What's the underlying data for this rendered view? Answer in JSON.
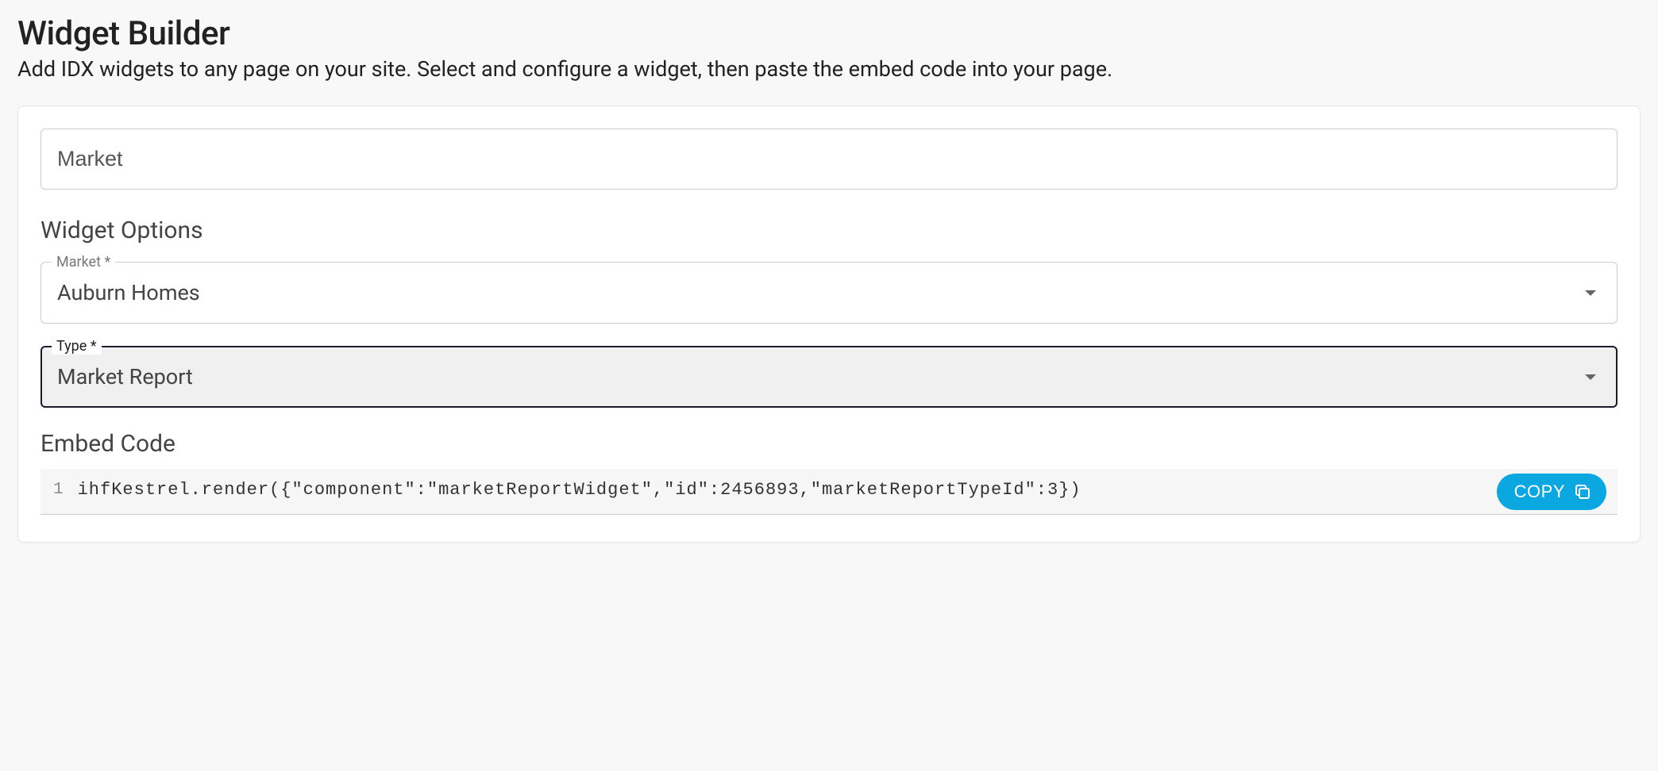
{
  "header": {
    "title": "Widget Builder",
    "subtitle": "Add IDX widgets to any page on your site. Select and configure a widget, then paste the embed code into your page."
  },
  "widget_name": "Market",
  "options_heading": "Widget Options",
  "fields": {
    "market": {
      "label": "Market *",
      "value": "Auburn Homes"
    },
    "type": {
      "label": "Type *",
      "value": "Market Report"
    }
  },
  "embed": {
    "heading": "Embed Code",
    "line_number": "1",
    "code": "ihfKestrel.render({\"component\":\"marketReportWidget\",\"id\":2456893,\"marketReportTypeId\":3})",
    "copy_label": "COPY"
  }
}
